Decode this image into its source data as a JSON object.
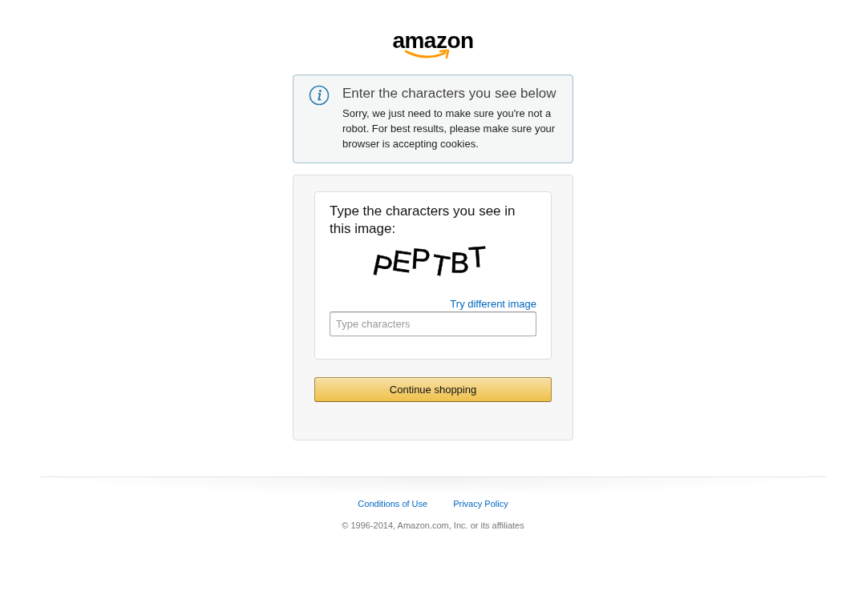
{
  "logo": {
    "text": "amazon"
  },
  "notice": {
    "title": "Enter the characters you see below",
    "message": "Sorry, we just need to make sure you're not a robot. For best results, please make sure your browser is accepting cookies."
  },
  "captcha": {
    "prompt": "Type the characters you see in this image:",
    "image_text": "PEPTBT",
    "refresh_link": "Try different image",
    "input": {
      "placeholder": "Type characters"
    }
  },
  "button": "Continue shopping",
  "footer": {
    "links": [
      "Conditions of Use",
      "Privacy Policy"
    ],
    "copyright": "© 1996-2014, Amazon.com, Inc. or its affiliates"
  }
}
